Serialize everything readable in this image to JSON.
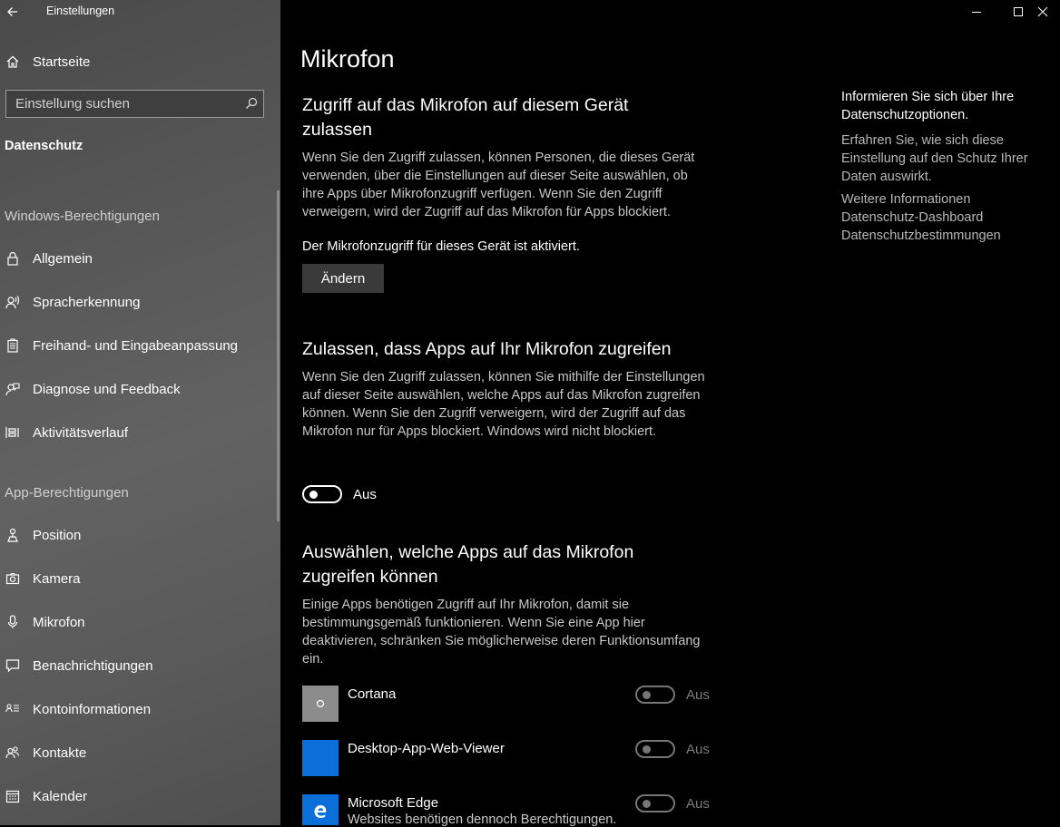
{
  "window": {
    "title": "Einstellungen"
  },
  "sidebar": {
    "home_label": "Startseite",
    "search_placeholder": "Einstellung suchen",
    "category": "Datenschutz",
    "sections": [
      {
        "title": "Windows-Berechtigungen",
        "items": [
          {
            "label": "Allgemein",
            "icon": "lock-icon"
          },
          {
            "label": "Spracherkennung",
            "icon": "speech-icon"
          },
          {
            "label": "Freihand- und Eingabeanpassung",
            "icon": "clipboard-icon"
          },
          {
            "label": "Diagnose und Feedback",
            "icon": "feedback-icon"
          },
          {
            "label": "Aktivitätsverlauf",
            "icon": "timeline-icon"
          }
        ]
      },
      {
        "title": "App-Berechtigungen",
        "items": [
          {
            "label": "Position",
            "icon": "location-icon"
          },
          {
            "label": "Kamera",
            "icon": "camera-icon"
          },
          {
            "label": "Mikrofon",
            "icon": "microphone-icon"
          },
          {
            "label": "Benachrichtigungen",
            "icon": "notification-icon"
          },
          {
            "label": "Kontoinformationen",
            "icon": "account-info-icon"
          },
          {
            "label": "Kontakte",
            "icon": "contacts-icon"
          },
          {
            "label": "Kalender",
            "icon": "calendar-icon"
          }
        ]
      }
    ]
  },
  "main": {
    "title": "Mikrofon",
    "device_access": {
      "heading": "Zugriff auf das Mikrofon auf diesem Gerät zulassen",
      "description": "Wenn Sie den Zugriff zulassen, können Personen, die dieses Gerät verwenden, über die Einstellungen auf dieser Seite auswählen, ob ihre Apps über Mikrofonzugriff verfügen. Wenn Sie den Zugriff verweigern, wird der Zugriff auf das Mikrofon für Apps blockiert.",
      "status": "Der Mikrofonzugriff für dieses Gerät ist aktiviert.",
      "change_button": "Ändern"
    },
    "app_access": {
      "heading": "Zulassen, dass Apps auf Ihr Mikrofon zugreifen",
      "description": "Wenn Sie den Zugriff zulassen, können Sie mithilfe der Einstellungen auf dieser Seite auswählen, welche Apps auf das Mikrofon zugreifen können. Wenn Sie den Zugriff verweigern, wird der Zugriff auf das Mikrofon nur für Apps blockiert. Windows wird nicht blockiert.",
      "toggle_state": "Aus"
    },
    "choose_apps": {
      "heading": "Auswählen, welche Apps auf das Mikrofon zugreifen können",
      "description": "Einige Apps benötigen Zugriff auf Ihr Mikrofon, damit sie bestimmungsgemäß funktionieren. Wenn Sie eine App hier deaktivieren, schränken Sie möglicherweise deren Funktionsumfang ein.",
      "apps": [
        {
          "name": "Cortana",
          "subtitle": "",
          "state": "Aus",
          "tile_color": "#8c8c8c"
        },
        {
          "name": "Desktop-App-Web-Viewer",
          "subtitle": "",
          "state": "Aus",
          "tile_color": "#0a6fd8"
        },
        {
          "name": "Microsoft Edge",
          "subtitle": "Websites benötigen dennoch Berechtigungen.",
          "state": "Aus",
          "tile_color": "#0a6fd8"
        }
      ]
    }
  },
  "right_panel": {
    "heading": "Informieren Sie sich über Ihre Datenschutzoptionen.",
    "text": "Erfahren Sie, wie sich diese Einstellung auf den Schutz Ihrer Daten auswirkt.",
    "links": [
      "Weitere Informationen",
      "Datenschutz-Dashboard",
      "Datenschutzbestimmungen"
    ]
  }
}
